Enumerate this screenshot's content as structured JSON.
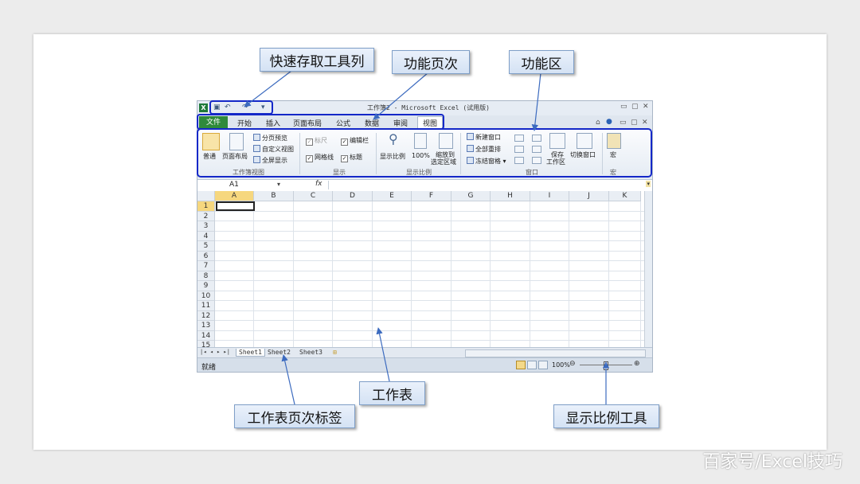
{
  "callouts": {
    "qat": "快速存取工具列",
    "tabs": "功能页次",
    "ribbon": "功能区",
    "worksheet": "工作表",
    "sheet_tabs": "工作表页次标签",
    "zoom": "显示比例工具"
  },
  "watermark": "百家号/Excel技巧",
  "colors": {
    "highlight": "#1428c8",
    "file_tab": "#2f8a3b",
    "callout_border": "#7f9fc8"
  },
  "excel": {
    "title": "工作簿2 - Microsoft Excel (试用版)",
    "tabs": {
      "file": "文件",
      "home": "开始",
      "insert": "插入",
      "page_layout": "页面布局",
      "formulas": "公式",
      "data": "数据",
      "review": "审阅",
      "view": "视图"
    },
    "ribbon": {
      "normal": "普通",
      "page_layout_view": "页面布局",
      "page_break_preview": "分页预览",
      "custom_views": "自定义视图",
      "full_screen": "全屏显示",
      "group_workbook_views": "工作簿视图",
      "ruler": "标尺",
      "formula_bar": "编辑栏",
      "gridlines": "网格线",
      "headings": "标题",
      "group_show": "显示",
      "zoom": "显示比例",
      "zoom_100": "100%",
      "zoom_selection_l1": "缩放到",
      "zoom_selection_l2": "选定区域",
      "group_zoom": "显示比例",
      "new_window": "新建窗口",
      "arrange_all": "全部重排",
      "freeze_panes": "冻结窗格",
      "save_workspace_l1": "保存",
      "save_workspace_l2": "工作区",
      "switch_windows": "切换窗口",
      "group_window": "窗口",
      "macros": "宏",
      "group_macros": "宏"
    },
    "name_box": "A1",
    "fx": "fx",
    "columns": [
      "A",
      "B",
      "C",
      "D",
      "E",
      "F",
      "G",
      "H",
      "I",
      "J",
      "K"
    ],
    "rows": [
      "1",
      "2",
      "3",
      "4",
      "5",
      "6",
      "7",
      "8",
      "9",
      "10",
      "11",
      "12",
      "13",
      "14",
      "15"
    ],
    "sheets": [
      "Sheet1",
      "Sheet2",
      "Sheet3"
    ],
    "status": "就绪",
    "zoom_level": "100%"
  }
}
